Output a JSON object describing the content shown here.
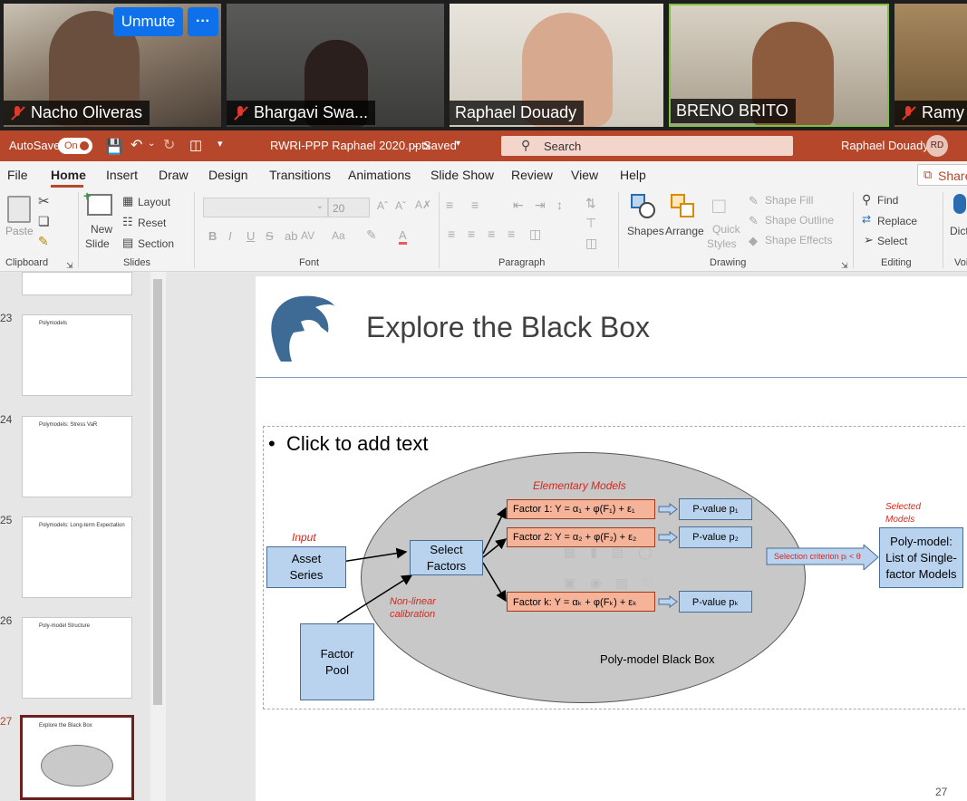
{
  "participants": [
    {
      "name": "Nacho Oliveras",
      "muted": true
    },
    {
      "name": "Bhargavi Swa...",
      "muted": true
    },
    {
      "name": "Raphael Douady",
      "muted": false
    },
    {
      "name": "BRENO BRITO",
      "muted": false
    },
    {
      "name": "Ramy",
      "muted": true
    }
  ],
  "call_controls": {
    "unmute": "Unmute",
    "more": "···"
  },
  "titlebar": {
    "autosave": "AutoSave",
    "autosave_state": "On",
    "filename": "RWRI-PPP Raphael 2020.pptx",
    "saved": "Saved",
    "search_placeholder": "Search",
    "user": "Raphael Douady",
    "initials": "RD"
  },
  "menu": [
    "File",
    "Home",
    "Insert",
    "Draw",
    "Design",
    "Transitions",
    "Animations",
    "Slide Show",
    "Review",
    "View",
    "Help"
  ],
  "share": "Share",
  "ribbon": {
    "clipboard": {
      "paste": "Paste",
      "group": "Clipboard"
    },
    "slides": {
      "new_slide": "New",
      "new_slide2": "Slide",
      "layout": "Layout",
      "reset": "Reset",
      "section": "Section",
      "group": "Slides"
    },
    "font": {
      "size": "20",
      "group": "Font"
    },
    "paragraph": {
      "group": "Paragraph"
    },
    "drawing": {
      "shapes": "Shapes",
      "arrange": "Arrange",
      "quick": "Quick",
      "styles": "Styles",
      "shape_fill": "Shape Fill",
      "shape_outline": "Shape Outline",
      "shape_effects": "Shape Effects",
      "group": "Drawing"
    },
    "editing": {
      "find": "Find",
      "replace": "Replace",
      "select": "Select",
      "group": "Editing"
    },
    "voice": {
      "dict": "Dict",
      "group": "Voi"
    }
  },
  "thumbnails": [
    {
      "num": "23",
      "title": "Polymodels"
    },
    {
      "num": "24",
      "title": "Polymodels: Stress VaR"
    },
    {
      "num": "25",
      "title": "Polymodels: Long-term Expectation"
    },
    {
      "num": "26",
      "title": "Poly-model Structure"
    },
    {
      "num": "27",
      "title": "Explore the Black Box",
      "selected": true
    }
  ],
  "slide": {
    "title": "Explore the Black Box",
    "placeholder": "Click to add text",
    "page_number": "27",
    "diagram": {
      "input_label": "Input",
      "asset_series": "Asset Series",
      "select_factors": "Select Factors",
      "factor_pool": "Factor Pool",
      "nonlinear": "Non-linear calibration",
      "elementary_models": "Elementary Models",
      "factor1": "Factor 1: Y = α₁ + φ(F₁) + ε₁",
      "factor2": "Factor 2: Y = α₂ + φ(F₂) + ε₂",
      "factork": "Factor k: Y = αₖ + φ(Fₖ) + εₖ",
      "pvalue1": "P-value  p₁",
      "pvalue2": "P-value  p₂",
      "pvaluek": "P-value  pₖ",
      "selection": "Selection criterion  pᵢ < θ",
      "selected_models": "Selected Models",
      "poly_model": "Poly-model: List of Single-factor Models",
      "black_box": "Poly-model Black Box"
    }
  },
  "colors": {
    "ppt_red": "#b7472a",
    "zoom_blue": "#0e71eb",
    "active_speaker": "#7dc243"
  }
}
